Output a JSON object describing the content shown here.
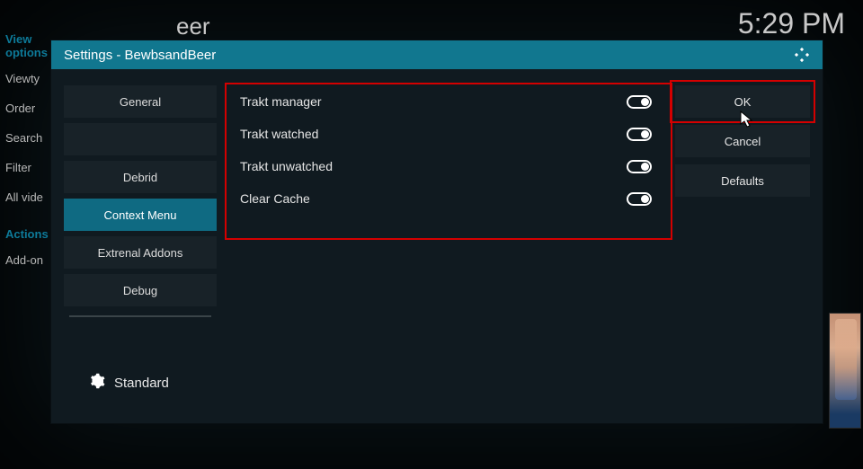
{
  "background": {
    "partial_title": "eer",
    "clock": "5:29 PM"
  },
  "left_panel": {
    "view_options_heading": "View options",
    "items": [
      "Viewty",
      "Order",
      "Search",
      "Filter",
      "All vide"
    ],
    "actions_heading": "Actions",
    "actions": [
      "Add-on"
    ]
  },
  "dialog": {
    "title": "Settings - BewbsandBeer",
    "categories": [
      {
        "label": "General",
        "active": false
      },
      {
        "label": "",
        "active": false
      },
      {
        "label": "Debrid",
        "active": false
      },
      {
        "label": "Context Menu",
        "active": true
      },
      {
        "label": "Extrenal Addons",
        "active": false
      },
      {
        "label": "Debug",
        "active": false
      }
    ],
    "level": "Standard",
    "settings": [
      {
        "label": "Trakt manager"
      },
      {
        "label": "Trakt watched"
      },
      {
        "label": "Trakt unwatched"
      },
      {
        "label": "Clear Cache"
      }
    ],
    "buttons": {
      "ok": "OK",
      "cancel": "Cancel",
      "defaults": "Defaults"
    }
  }
}
